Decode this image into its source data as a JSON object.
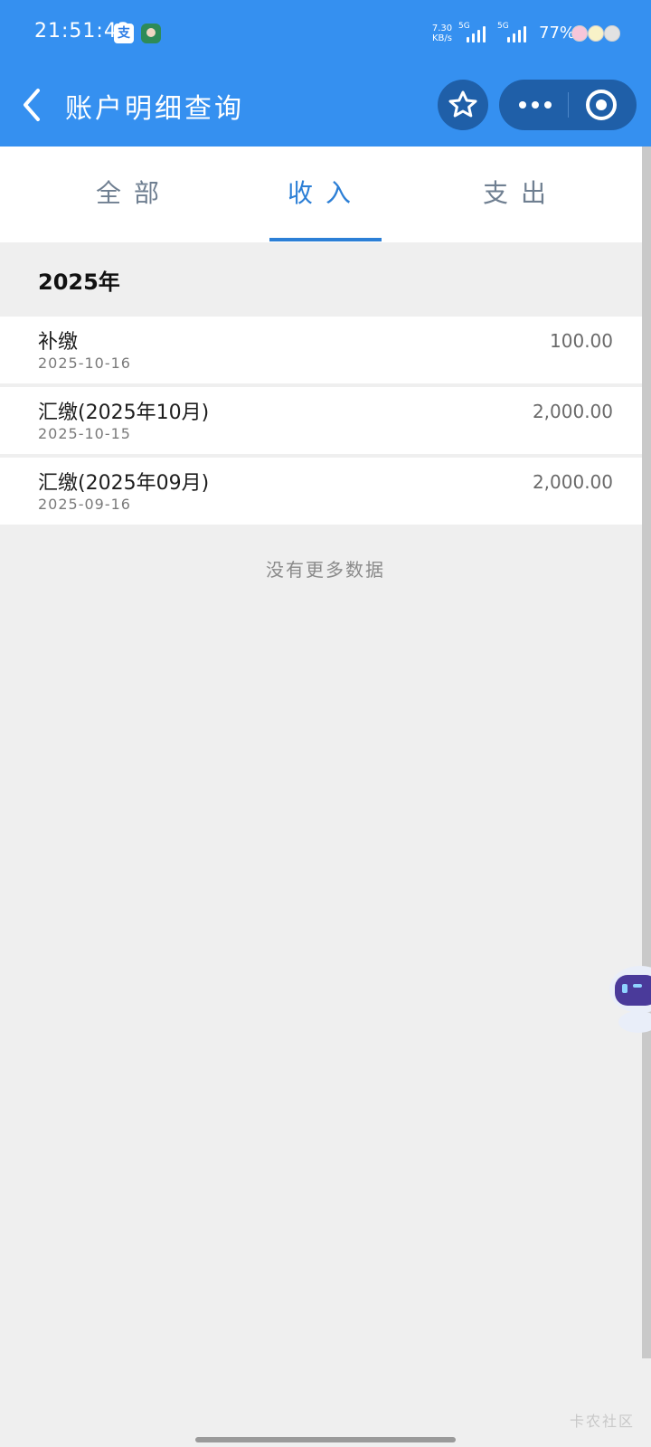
{
  "status_bar": {
    "time": "21:51:43",
    "net_speed": "7.30",
    "net_unit": "KB/s",
    "sim1_label": "5G",
    "sim2_label": "5G",
    "battery": "77%"
  },
  "nav": {
    "title": "账户明细查询",
    "icons": [
      "back-icon",
      "star-icon",
      "more-icon",
      "target-icon"
    ]
  },
  "tabs": [
    {
      "label": "全部",
      "active": false
    },
    {
      "label": "收入",
      "active": true
    },
    {
      "label": "支出",
      "active": false
    }
  ],
  "year_label": "2025年",
  "records": [
    {
      "title": "补缴",
      "date": "2025-10-16",
      "amount": "100.00"
    },
    {
      "title": "汇缴(2025年10月)",
      "date": "2025-10-15",
      "amount": "2,000.00"
    },
    {
      "title": "汇缴(2025年09月)",
      "date": "2025-09-16",
      "amount": "2,000.00"
    }
  ],
  "footer_note": "没有更多数据",
  "watermark": "卡农社区",
  "colors": {
    "brand_blue": "#3590f0",
    "tab_active": "#2c7fd6",
    "page_bg": "#efefef"
  }
}
